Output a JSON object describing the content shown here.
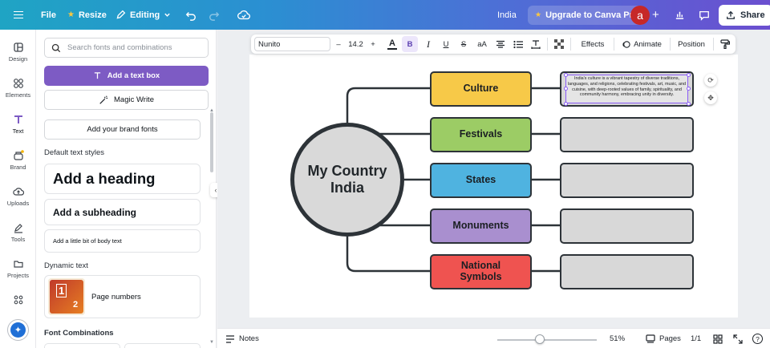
{
  "topbar": {
    "file": "File",
    "resize": "Resize",
    "editing": "Editing",
    "doc_title": "India",
    "upgrade": "Upgrade to Canva Pro",
    "avatar_letter": "a",
    "share": "Share"
  },
  "rail": [
    {
      "label": "Design",
      "icon": "layout-icon"
    },
    {
      "label": "Elements",
      "icon": "shapes-icon"
    },
    {
      "label": "Text",
      "icon": "text-t-icon"
    },
    {
      "label": "Brand",
      "icon": "brand-icon"
    },
    {
      "label": "Uploads",
      "icon": "cloud-upload-icon"
    },
    {
      "label": "Tools",
      "icon": "pen-icon"
    },
    {
      "label": "Projects",
      "icon": "folder-icon"
    }
  ],
  "panel": {
    "search_placeholder": "Search fonts and combinations",
    "add_text_box": "Add a text box",
    "magic_write": "Magic Write",
    "brand_fonts": "Add your brand fonts",
    "default_styles": "Default text styles",
    "heading": "Add a heading",
    "subheading": "Add a subheading",
    "body": "Add a little bit of body text",
    "dynamic_text": "Dynamic text",
    "page_numbers": "Page numbers",
    "thumb_top": "1",
    "thumb_bottom": "2",
    "font_combinations": "Font Combinations"
  },
  "toolbar": {
    "font": "Nunito",
    "minus": "–",
    "size": "14.2",
    "plus": "+",
    "effects": "Effects",
    "animate": "Animate",
    "position": "Position"
  },
  "mindmap": {
    "center_line1": "My Country",
    "center_line2": "India",
    "nodes": [
      {
        "label": "Culture",
        "color": "#f7c948"
      },
      {
        "label": "Festivals",
        "color": "#9ccc65"
      },
      {
        "label": "States",
        "color": "#4fb3e0"
      },
      {
        "label": "Monuments",
        "color": "#a98fcf"
      },
      {
        "label_line1": "National",
        "label_line2": "Symbols",
        "color": "#ef5350"
      }
    ],
    "culture_text": "India's culture is a vibrant tapestry of diverse traditions, languages, and religions, celebrating festivals, art, music, and cuisine, with deep-rooted values of family, spirituality, and community harmony, embracing unity in diversity."
  },
  "bottombar": {
    "notes": "Notes",
    "zoom": "51%",
    "pages": "Pages",
    "page_count": "1/1",
    "help": "?"
  }
}
